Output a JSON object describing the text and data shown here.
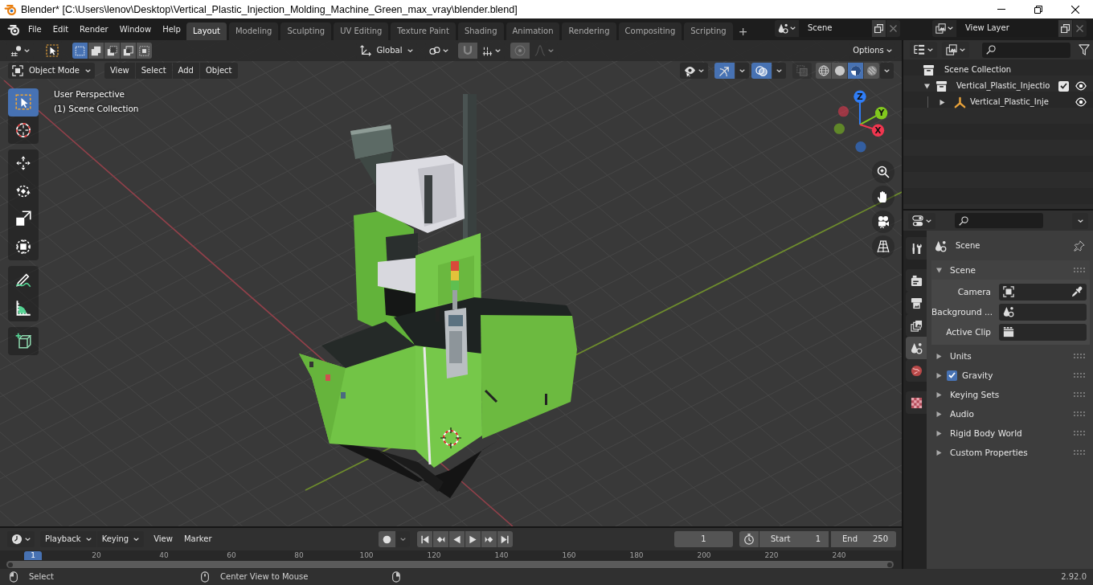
{
  "window": {
    "title": "Blender* [C:\\Users\\lenov\\Desktop\\Vertical_Plastic_Injection_Molding_Machine_Green_max_vray\\blender.blend]"
  },
  "topbar": {
    "menus": [
      "File",
      "Edit",
      "Render",
      "Window",
      "Help"
    ],
    "workspaces": [
      {
        "label": "Layout",
        "selected": true
      },
      {
        "label": "Modeling",
        "selected": false
      },
      {
        "label": "Sculpting",
        "selected": false
      },
      {
        "label": "UV Editing",
        "selected": false
      },
      {
        "label": "Texture Paint",
        "selected": false
      },
      {
        "label": "Shading",
        "selected": false
      },
      {
        "label": "Animation",
        "selected": false
      },
      {
        "label": "Rendering",
        "selected": false
      },
      {
        "label": "Compositing",
        "selected": false
      },
      {
        "label": "Scripting",
        "selected": false
      }
    ],
    "add_workspace": "+",
    "scene": "Scene",
    "view_layer": "View Layer"
  },
  "viewport": {
    "tool_header": {
      "select_modes": [
        {
          "selected": true
        },
        {
          "selected": false
        },
        {
          "selected": false
        },
        {
          "selected": false
        },
        {
          "selected": false
        }
      ],
      "orientation": "Global",
      "options": "Options"
    },
    "header": {
      "mode": "Object Mode",
      "menus": [
        "View",
        "Select",
        "Add",
        "Object"
      ],
      "gizmos": true,
      "overlays": true,
      "xray": false,
      "shading": [
        {
          "kind": "wireframe",
          "selected": false
        },
        {
          "kind": "solid",
          "selected": false
        },
        {
          "kind": "material",
          "selected": true
        },
        {
          "kind": "rendered",
          "selected": false
        }
      ]
    },
    "tool_groups": [
      [
        {
          "kind": "select",
          "selected": true
        },
        {
          "kind": "cursor",
          "selected": false
        }
      ],
      [
        {
          "kind": "move",
          "selected": false
        },
        {
          "kind": "rotate",
          "selected": false
        },
        {
          "kind": "scale",
          "selected": false
        },
        {
          "kind": "transform",
          "selected": false
        }
      ],
      [
        {
          "kind": "annotate",
          "selected": false
        },
        {
          "kind": "measure",
          "selected": false
        }
      ],
      [
        {
          "kind": "add_cube",
          "selected": false
        }
      ]
    ],
    "view_name": "User Perspective",
    "collection": "(1) Scene Collection",
    "axes": [
      {
        "label": "Z",
        "color": "#2f7df6"
      },
      {
        "label": "Y",
        "color": "#82c91e"
      },
      {
        "label": "X",
        "color": "#f0364f"
      }
    ]
  },
  "outliner": {
    "root": "Scene Collection",
    "children": [
      {
        "label": "Vertical_Plastic_Injectio",
        "kind": "collection",
        "expanded": true,
        "checked": true,
        "visible": true,
        "children": [
          {
            "label": "Vertical_Plastic_Inje",
            "kind": "empty",
            "expanded": false,
            "visible": true
          }
        ]
      }
    ]
  },
  "properties": {
    "tab_groups": [
      [
        {
          "kind": "tool",
          "selected": false
        }
      ],
      [
        {
          "kind": "render",
          "selected": false
        },
        {
          "kind": "output",
          "selected": false
        },
        {
          "kind": "view_layer",
          "selected": false
        },
        {
          "kind": "scene",
          "selected": true
        },
        {
          "kind": "world",
          "selected": false
        }
      ],
      [
        {
          "kind": "texture",
          "selected": false
        }
      ]
    ],
    "context": "Scene",
    "panels": [
      {
        "title": "Scene",
        "kind": "plain",
        "expanded": true,
        "fields": [
          {
            "label": "Camera",
            "kind": "camera"
          },
          {
            "label": "Background ...",
            "kind": "scene"
          },
          {
            "label": "Active Clip",
            "kind": "clip"
          }
        ]
      },
      {
        "title": "Units",
        "kind": "plain",
        "expanded": false
      },
      {
        "title": "Gravity",
        "kind": "checkbox",
        "expanded": false,
        "checked": true
      },
      {
        "title": "Keying Sets",
        "kind": "plain",
        "expanded": false
      },
      {
        "title": "Audio",
        "kind": "plain",
        "expanded": false
      },
      {
        "title": "Rigid Body World",
        "kind": "plain",
        "expanded": false
      },
      {
        "title": "Custom Properties",
        "kind": "plain",
        "expanded": false
      }
    ]
  },
  "timeline": {
    "menus": [
      {
        "label": "Playback",
        "kind": "dropdown"
      },
      {
        "label": "Keying",
        "kind": "dropdown"
      },
      {
        "label": "View",
        "kind": "menu"
      },
      {
        "label": "Marker",
        "kind": "menu"
      }
    ],
    "current_frame": "1",
    "start": {
      "label": "Start",
      "value": "1"
    },
    "end": {
      "label": "End",
      "value": "250"
    },
    "playhead": "1",
    "ruler": [
      "20",
      "40",
      "60",
      "80",
      "100",
      "120",
      "140",
      "160",
      "180",
      "200",
      "220",
      "240"
    ]
  },
  "status_bar": {
    "hints": [
      {
        "kind": "left",
        "label": "Select"
      },
      {
        "kind": "middle",
        "label": "Center View to Mouse"
      },
      {
        "kind": "right"
      }
    ],
    "version": "2.92.0"
  }
}
